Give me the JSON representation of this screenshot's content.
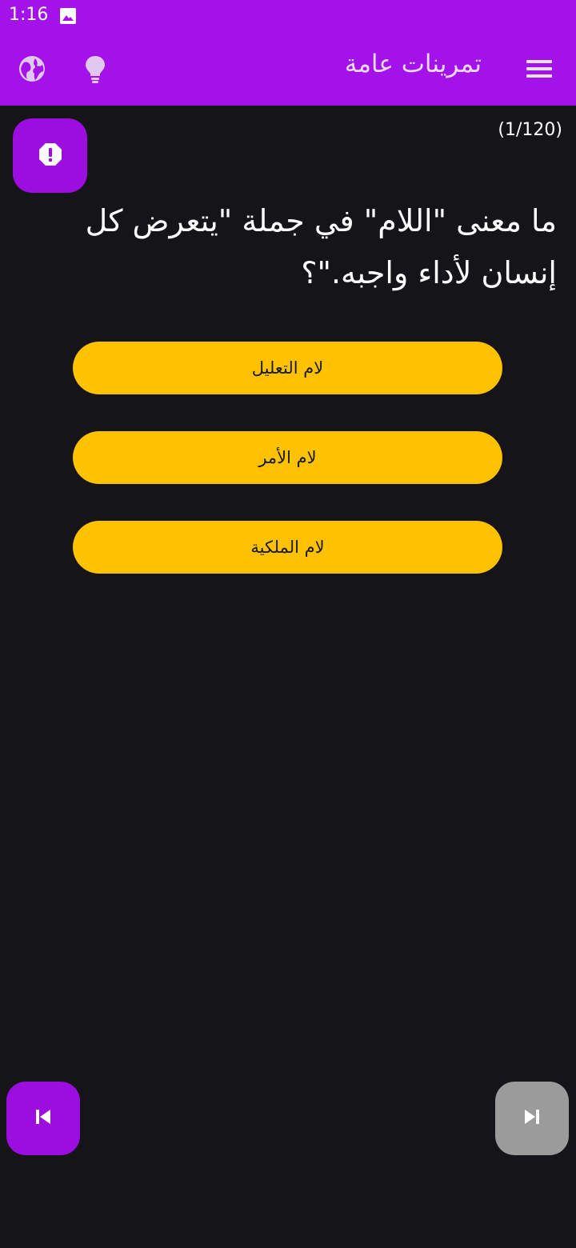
{
  "status_bar": {
    "time": "1:16",
    "icons": [
      "image-icon"
    ]
  },
  "app_bar": {
    "title": "تمرينات عامة",
    "icons": [
      "globe-icon",
      "lightbulb-icon",
      "menu-icon"
    ]
  },
  "quiz": {
    "counter": "(1/120)",
    "question": "ما معنى \"اللام\" في جملة \"يتعرض كل إنسان لأداء واجبه.\"؟",
    "answers": [
      "لام التعليل",
      "لام الأمر",
      "لام الملكية"
    ]
  },
  "navigation": {
    "prev_icon": "skip-previous-icon",
    "next_icon": "skip-next-icon"
  },
  "report_icon": "report-warning-icon",
  "colors": {
    "primary": "#a312e8",
    "button_purple": "#9c0ee0",
    "answer_yellow": "#fec201",
    "background": "#141419",
    "disabled_gray": "#9b9b9b"
  }
}
